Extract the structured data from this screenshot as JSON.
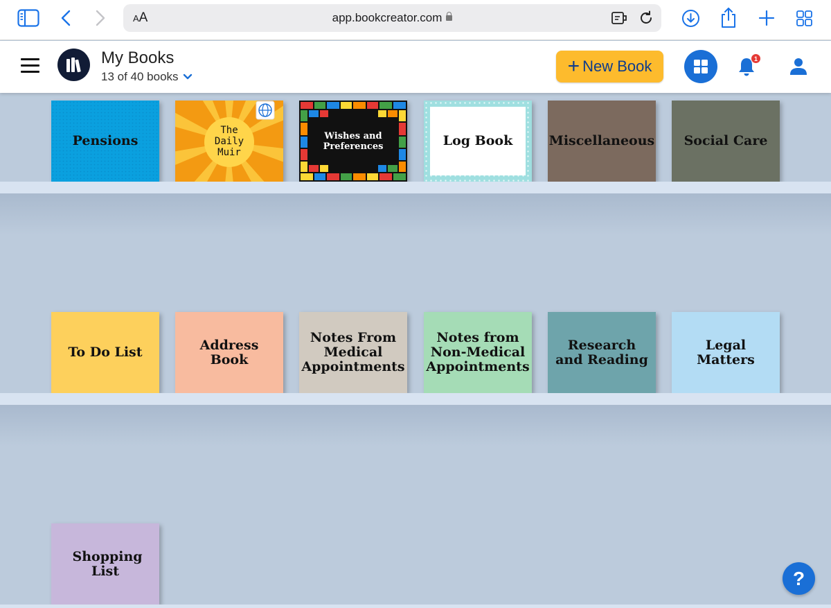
{
  "browser": {
    "text_size_label": "AA",
    "url": "app.bookcreator.com"
  },
  "header": {
    "title": "My Books",
    "subtitle": "13 of 40 books",
    "new_book_label": "New Book",
    "notification_count": "1"
  },
  "colors": {
    "accent_blue": "#1a6fd6",
    "new_book_yellow": "#fdbb2d",
    "shelf": "#d8e3f1",
    "background": "#bccbdc"
  },
  "books": [
    {
      "title": "Pensions",
      "color": "#0aa0df"
    },
    {
      "title": "The Daily Muir",
      "color": "#f5a114",
      "icon": "globe-icon"
    },
    {
      "title": "Wishes and Preferences",
      "color": "#111111"
    },
    {
      "title": "Log Book",
      "color": "#ffffff"
    },
    {
      "title": "Miscellaneous",
      "color": "#7c6a5e"
    },
    {
      "title": "Social Care",
      "color": "#6b7163"
    },
    {
      "title": "To Do List",
      "color": "#fdd05c"
    },
    {
      "title": "Address Book",
      "color": "#f8bb9f"
    },
    {
      "title": "Notes From Medical Appointments",
      "color": "#d1cac0"
    },
    {
      "title": "Notes from Non-Medical Appointments",
      "color": "#a5dcb6"
    },
    {
      "title": "Research and Reading",
      "color": "#6ea4ab"
    },
    {
      "title": "Legal Matters",
      "color": "#b3dcf4"
    },
    {
      "title": "Shopping List",
      "color": "#c7b7db"
    }
  ],
  "help_label": "?"
}
